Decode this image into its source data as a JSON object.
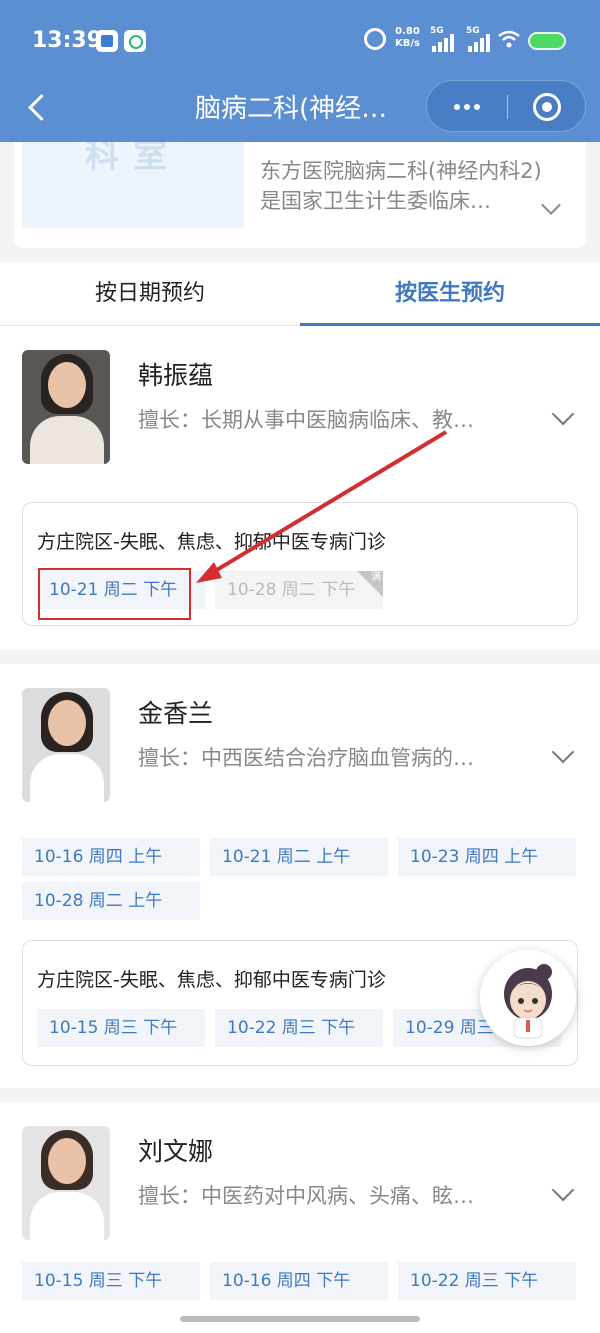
{
  "status_bar": {
    "time": "13:39",
    "net_speed": "0.80",
    "net_unit": "KB/s",
    "sig1": "5G",
    "sig2": "5G"
  },
  "nav": {
    "title": "脑病二科(神经…"
  },
  "dept": {
    "logo_text": "科室",
    "description": "东方医院脑病二科(神经内科2)是国家卫生计生委临床…"
  },
  "tabs": [
    {
      "label": "按日期预约"
    },
    {
      "label": "按医生预约"
    }
  ],
  "doctors": [
    {
      "name": "韩振蕴",
      "skill": "擅长：长期从事中医脑病临床、教…",
      "clinics": [
        {
          "title": "方庄院区-失眠、焦虑、抑郁中医专病门诊",
          "slots": [
            "10-21 周二 下午",
            "10-28 周二 下午"
          ],
          "full_label": "满"
        }
      ]
    },
    {
      "name": "金香兰",
      "skill": "擅长：中西医结合治疗脑血管病的…",
      "slots": [
        "10-16 周四 上午",
        "10-21 周二 上午",
        "10-23 周四 上午",
        "10-28 周二 上午"
      ],
      "clinics": [
        {
          "title": "方庄院区-失眠、焦虑、抑郁中医专病门诊",
          "slots": [
            "10-15 周三 下午",
            "10-22 周三 下午",
            "10-29 周三"
          ]
        }
      ]
    },
    {
      "name": "刘文娜",
      "skill": "擅长：中医药对中风病、头痛、眩…",
      "slots": [
        "10-15 周三 下午",
        "10-16 周四 下午",
        "10-22 周三 下午"
      ]
    }
  ],
  "colors": {
    "header": "#5b8fd1",
    "accent": "#3e79c2",
    "annotation": "#d32f2f"
  }
}
